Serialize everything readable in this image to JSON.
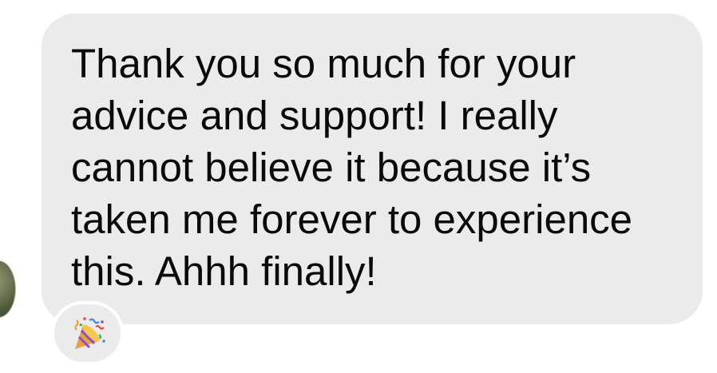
{
  "message": {
    "lines": [
      "Thank you so much for your",
      "advice and support! I really",
      "cannot believe it because it’s",
      "taken me forever to experience",
      "this. Ahhh finally!"
    ],
    "reaction_icon": "party-popper-icon"
  },
  "colors": {
    "bubble": "#ebebeb",
    "text": "#0a0a0a",
    "background": "#ffffff"
  }
}
